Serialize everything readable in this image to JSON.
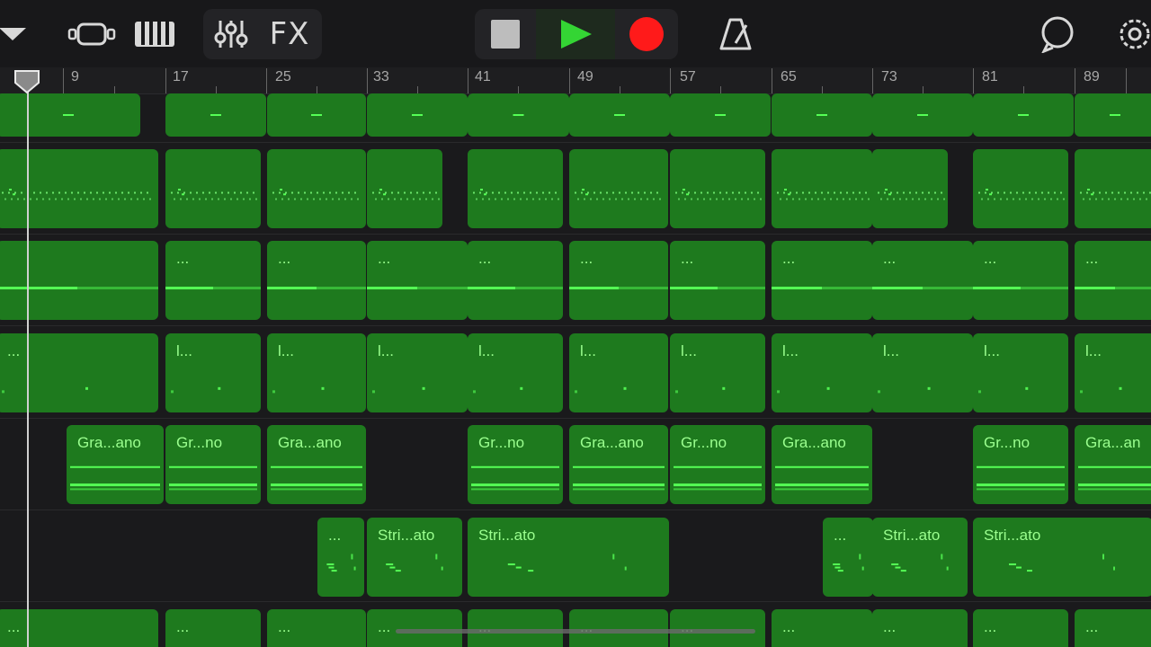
{
  "toolbar": {
    "fx_label": "FX",
    "icons": [
      "dropdown-icon",
      "tracks-view-icon",
      "keyboard-icon",
      "mixer-icon",
      "stop-icon",
      "play-icon",
      "record-icon",
      "metronome-icon",
      "loop-browser-icon",
      "settings-icon"
    ]
  },
  "ruler": {
    "bars": [
      "9",
      "17",
      "25",
      "33",
      "41",
      "49",
      "57",
      "65",
      "73",
      "81",
      "89"
    ]
  },
  "regions": {
    "pads2": "...",
    "pads3": "...",
    "l4": "l...",
    "dots4": "...",
    "piano_long": "Gra...ano",
    "piano_short": "Gr...no",
    "piano_cut": "Gra...an",
    "strings": "Stri...ato",
    "strings_dots": "..."
  },
  "colors": {
    "region_fill": "#1e7a1e",
    "region_label": "#9bff8f",
    "note_bright": "#55ff55",
    "record": "#ff1a1a",
    "play": "#34d534"
  }
}
